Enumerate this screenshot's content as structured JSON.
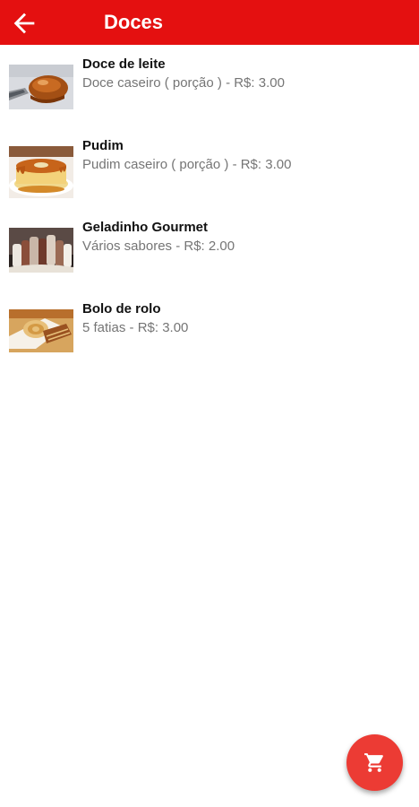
{
  "header": {
    "back_icon": "arrow-left-icon",
    "title": "Doces"
  },
  "products": [
    {
      "name": "Doce de leite",
      "description": "Doce caseiro ( porção ) - R$: 3.00",
      "image": "doce-de-leite-photo"
    },
    {
      "name": "Pudim",
      "description": "Pudim caseiro ( porção ) - R$: 3.00",
      "image": "pudim-photo"
    },
    {
      "name": "Geladinho Gourmet",
      "description": "Vários sabores - R$: 2.00",
      "image": "geladinho-photo"
    },
    {
      "name": "Bolo de rolo",
      "description": "5 fatias - R$: 3.00",
      "image": "bolo-de-rolo-photo"
    }
  ],
  "fab": {
    "icon": "shopping-cart-icon"
  },
  "colors": {
    "app_bar": "#e41010",
    "fab": "#ec3b34",
    "title_text": "#ffffff",
    "name_text": "#111111",
    "description_text": "#757575"
  }
}
